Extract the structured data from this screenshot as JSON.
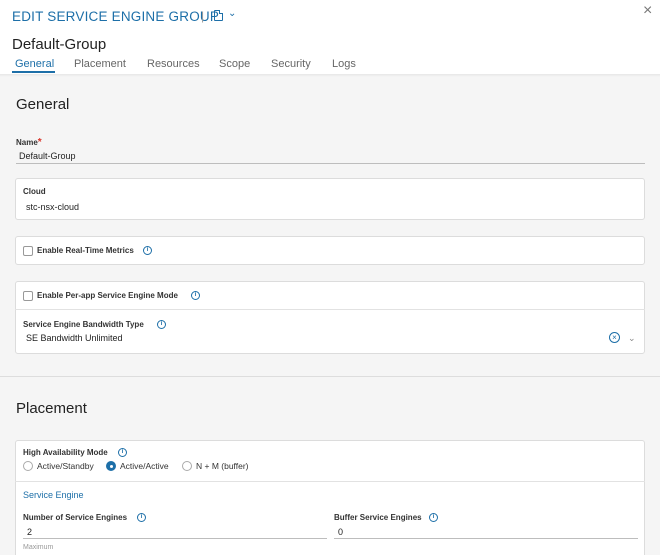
{
  "header": {
    "edit_title": "EDIT SERVICE ENGINE GROUP",
    "separator": "|",
    "object_name": "Default-Group",
    "tabs": [
      {
        "label": "General"
      },
      {
        "label": "Placement"
      },
      {
        "label": "Resources"
      },
      {
        "label": "Scope"
      },
      {
        "label": "Security"
      },
      {
        "label": "Logs"
      }
    ],
    "active_tab": "General"
  },
  "general": {
    "section_title": "General",
    "name_label": "Name",
    "required_mark": "*",
    "name_value": "Default-Group",
    "cloud_label": "Cloud",
    "cloud_value": "stc-nsx-cloud",
    "realtime_metrics_label": "Enable Real-Time Metrics",
    "per_app_label": "Enable Per-app Service Engine Mode",
    "bandwidth_label": "Service Engine Bandwidth Type",
    "bandwidth_value": "SE Bandwidth Unlimited"
  },
  "placement": {
    "section_title": "Placement",
    "ha_mode_label": "High Availability Mode",
    "ha_options": [
      {
        "label": "Active/Standby",
        "selected": false
      },
      {
        "label": "Active/Active",
        "selected": true
      },
      {
        "label": "N + M (buffer)",
        "selected": false
      }
    ],
    "service_engine_subhead": "Service Engine",
    "num_se_label": "Number of Service Engines",
    "num_se_value": "2",
    "num_se_hint": "Maximum",
    "buffer_se_label": "Buffer Service Engines",
    "buffer_se_value": "0"
  },
  "icons": {
    "info": "i",
    "close": "×",
    "chevron": "⌄",
    "clear": "×"
  },
  "colors": {
    "accent": "#1d6fa8",
    "required": "#d9352b"
  }
}
